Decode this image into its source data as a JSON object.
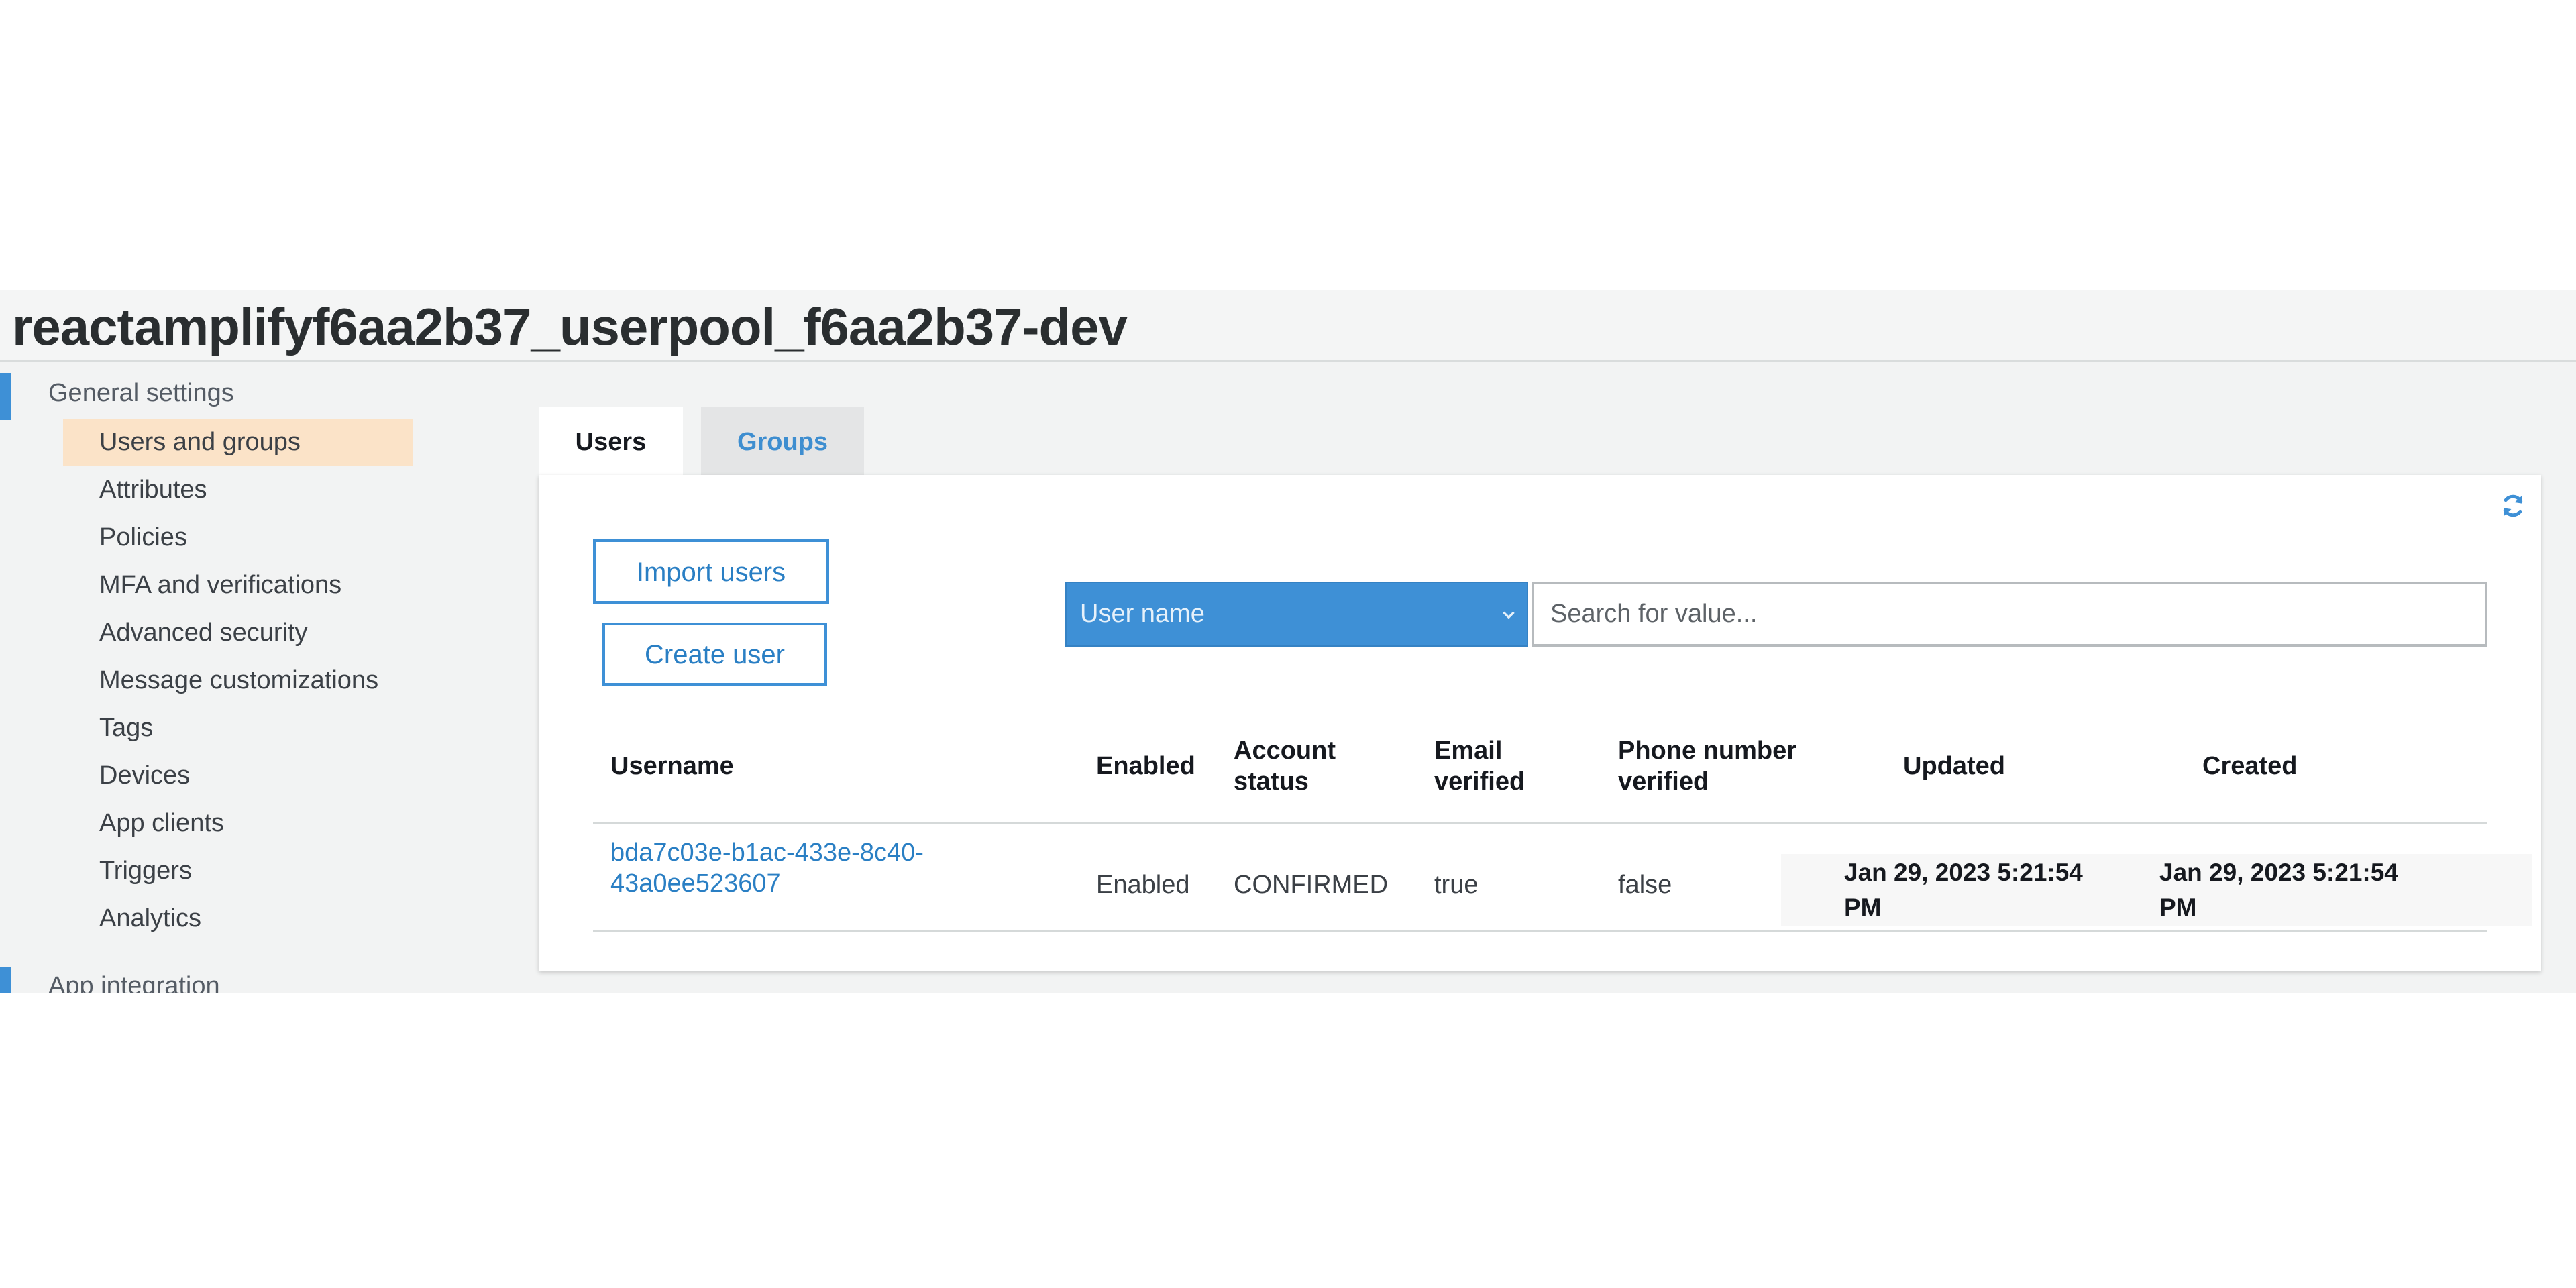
{
  "header": {
    "title": "reactamplifyf6aa2b37_userpool_f6aa2b37-dev"
  },
  "sidebar": {
    "section_general": "General settings",
    "section_app": "App integration",
    "items": [
      {
        "label": "Users and groups",
        "active": true
      },
      {
        "label": "Attributes"
      },
      {
        "label": "Policies"
      },
      {
        "label": "MFA and verifications"
      },
      {
        "label": "Advanced security"
      },
      {
        "label": "Message customizations"
      },
      {
        "label": "Tags"
      },
      {
        "label": "Devices"
      },
      {
        "label": "App clients"
      },
      {
        "label": "Triggers"
      },
      {
        "label": "Analytics"
      }
    ]
  },
  "tabs": {
    "users": "Users",
    "groups": "Groups",
    "active": "Users"
  },
  "toolbar": {
    "import_label": "Import users",
    "create_label": "Create user"
  },
  "search": {
    "attribute_selected": "User name",
    "placeholder": "Search for value..."
  },
  "table": {
    "headers": {
      "username": "Username",
      "enabled": "Enabled",
      "account_status_1": "Account",
      "account_status_2": "status",
      "email_verified_1": "Email",
      "email_verified_2": "verified",
      "phone_verified_1": "Phone number",
      "phone_verified_2": "verified",
      "updated": "Updated",
      "created": "Created"
    },
    "rows": [
      {
        "username_1": "bda7c03e-b1ac-433e-8c40-",
        "username_2": "43a0ee523607",
        "enabled": "Enabled",
        "account_status": "CONFIRMED",
        "email_verified": "true",
        "phone_verified": "false",
        "updated_1": "Jan 29, 2023 5:21:54",
        "updated_2": "PM",
        "created_1": "Jan 29, 2023 5:21:54",
        "created_2": "PM"
      }
    ]
  },
  "colors": {
    "accent": "#3e90d6",
    "active_item_bg": "#fbe3c8"
  },
  "icons": {
    "refresh": "refresh-icon",
    "dropdown": "chevron-down-icon"
  }
}
